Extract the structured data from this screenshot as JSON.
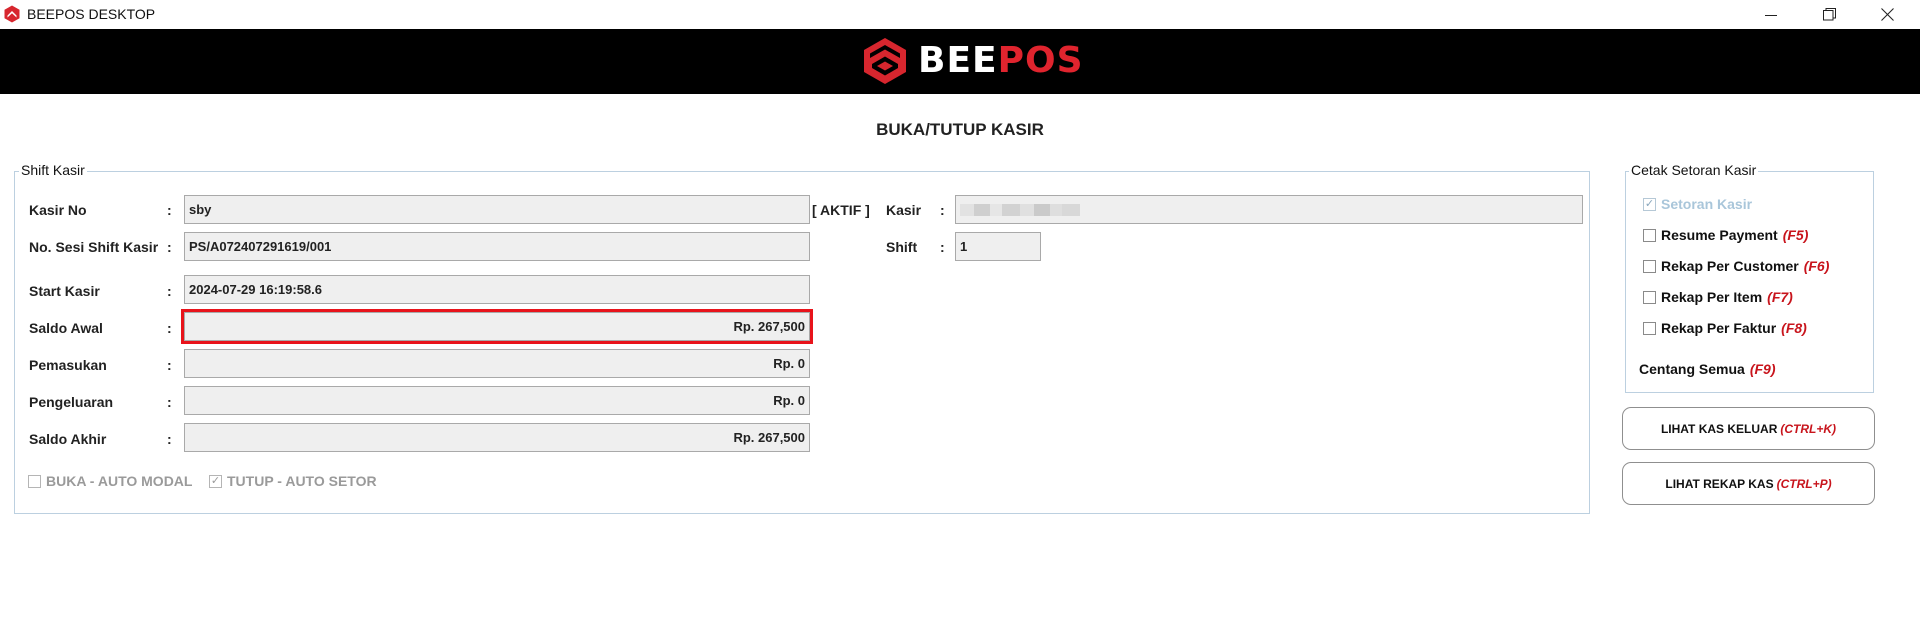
{
  "window": {
    "title": "BEEPOS DESKTOP"
  },
  "brand": {
    "part1": "BEE",
    "part2": "POS",
    "accent_color": "#e0242e"
  },
  "page": {
    "title": "BUKA/TUTUP KASIR"
  },
  "shift_kasir": {
    "legend": "Shift Kasir",
    "colon": ":",
    "kasir_no": {
      "label": "Kasir No",
      "value": "sby"
    },
    "status": "[ AKTIF ]",
    "kasir": {
      "label": "Kasir",
      "value": ""
    },
    "no_sesi": {
      "label": "No. Sesi Shift Kasir",
      "value": "PS/A072407291619/001"
    },
    "shift": {
      "label": "Shift",
      "value": "1"
    },
    "start_kasir": {
      "label": "Start Kasir",
      "value": "2024-07-29 16:19:58.6"
    },
    "saldo_awal": {
      "label": "Saldo Awal",
      "value": "Rp. 267,500"
    },
    "pemasukan": {
      "label": "Pemasukan",
      "value": "Rp. 0"
    },
    "pengeluaran": {
      "label": "Pengeluaran",
      "value": "Rp. 0"
    },
    "saldo_akhir": {
      "label": "Saldo Akhir",
      "value": "Rp. 267,500"
    },
    "buka_auto_modal": {
      "label": "BUKA - AUTO MODAL",
      "checked": false
    },
    "tutup_auto_setor": {
      "label": "TUTUP - AUTO SETOR",
      "checked": true
    }
  },
  "cetak_setoran": {
    "legend": "Cetak Setoran Kasir",
    "items": [
      {
        "label": "Setoran Kasir",
        "key": "",
        "checked": true
      },
      {
        "label": "Resume Payment",
        "key": "(F5)",
        "checked": false
      },
      {
        "label": "Rekap Per Customer",
        "key": "(F6)",
        "checked": false
      },
      {
        "label": "Rekap Per Item",
        "key": "(F7)",
        "checked": false
      },
      {
        "label": "Rekap Per Faktur",
        "key": "(F8)",
        "checked": false
      }
    ],
    "centang_semua": {
      "label": "Centang Semua",
      "key": "(F9)"
    }
  },
  "buttons": {
    "lihat_kas_keluar": {
      "label": "LIHAT KAS KELUAR",
      "key": "(CTRL+K)"
    },
    "lihat_rekap_kas": {
      "label": "LIHAT REKAP KAS",
      "key": "(CTRL+P)"
    }
  }
}
